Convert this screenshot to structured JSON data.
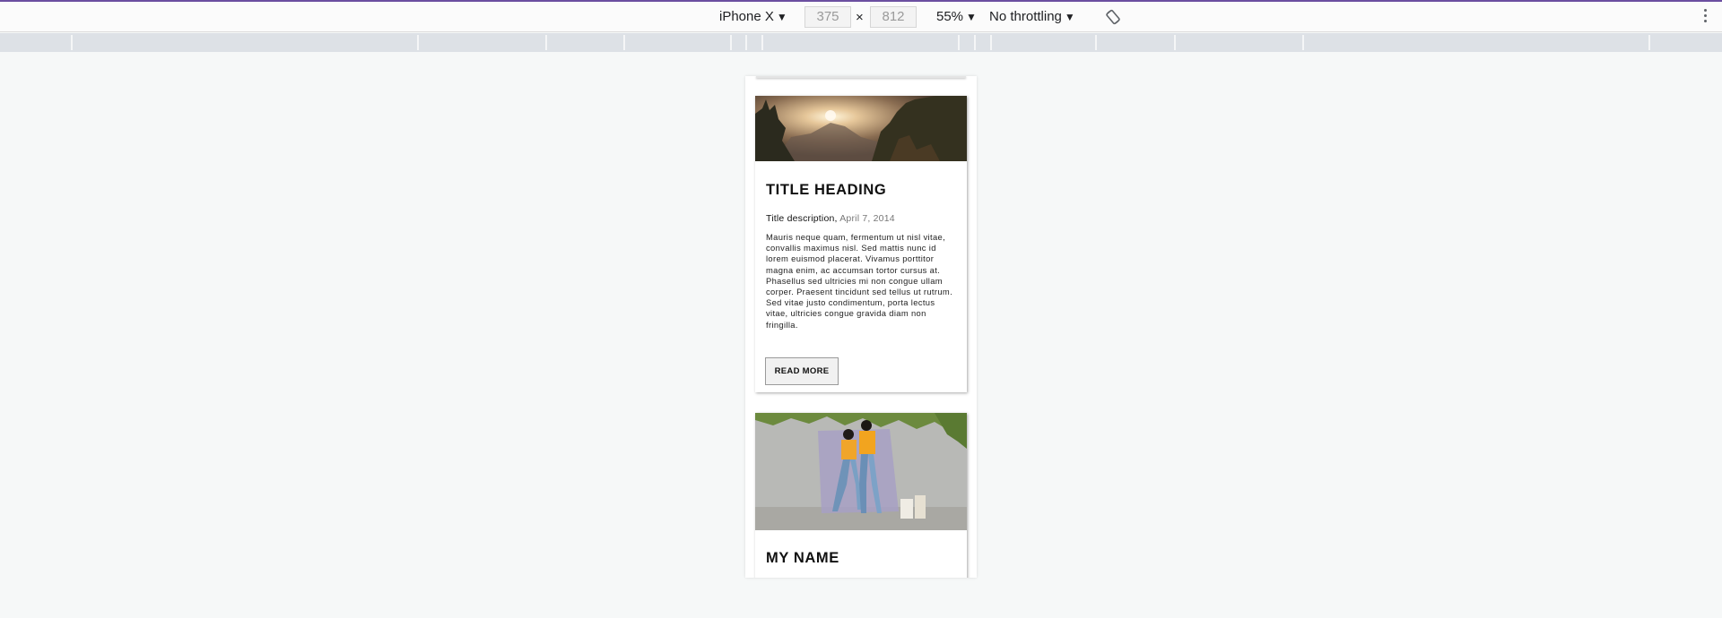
{
  "toolbar": {
    "device": "iPhone X",
    "width": "375",
    "height": "812",
    "separator": "×",
    "zoom": "55%",
    "throttling": "No throttling",
    "caret": "▼",
    "accent_color": "#6b4fa0"
  },
  "cards": [
    {
      "title": "TITLE HEADING",
      "subtitle": "Title description,",
      "date": "April 7, 2014",
      "body": "Mauris neque quam, fermentum ut nisl vitae, convallis maximus nisl. Sed mattis nunc id lorem euismod placerat. Vivamus porttitor magna enim, ac accumsan tortor cursus at. Phasellus sed ultricies mi non congue ullam corper. Praesent tincidunt sed tellus ut rutrum. Sed vitae justo condimentum, porta lectus vitae, ultricies congue gravida diam non fringilla.",
      "button": "READ MORE",
      "image": "mountain-sunset-image"
    },
    {
      "title": "MY NAME",
      "image": "couple-photo-image"
    }
  ]
}
